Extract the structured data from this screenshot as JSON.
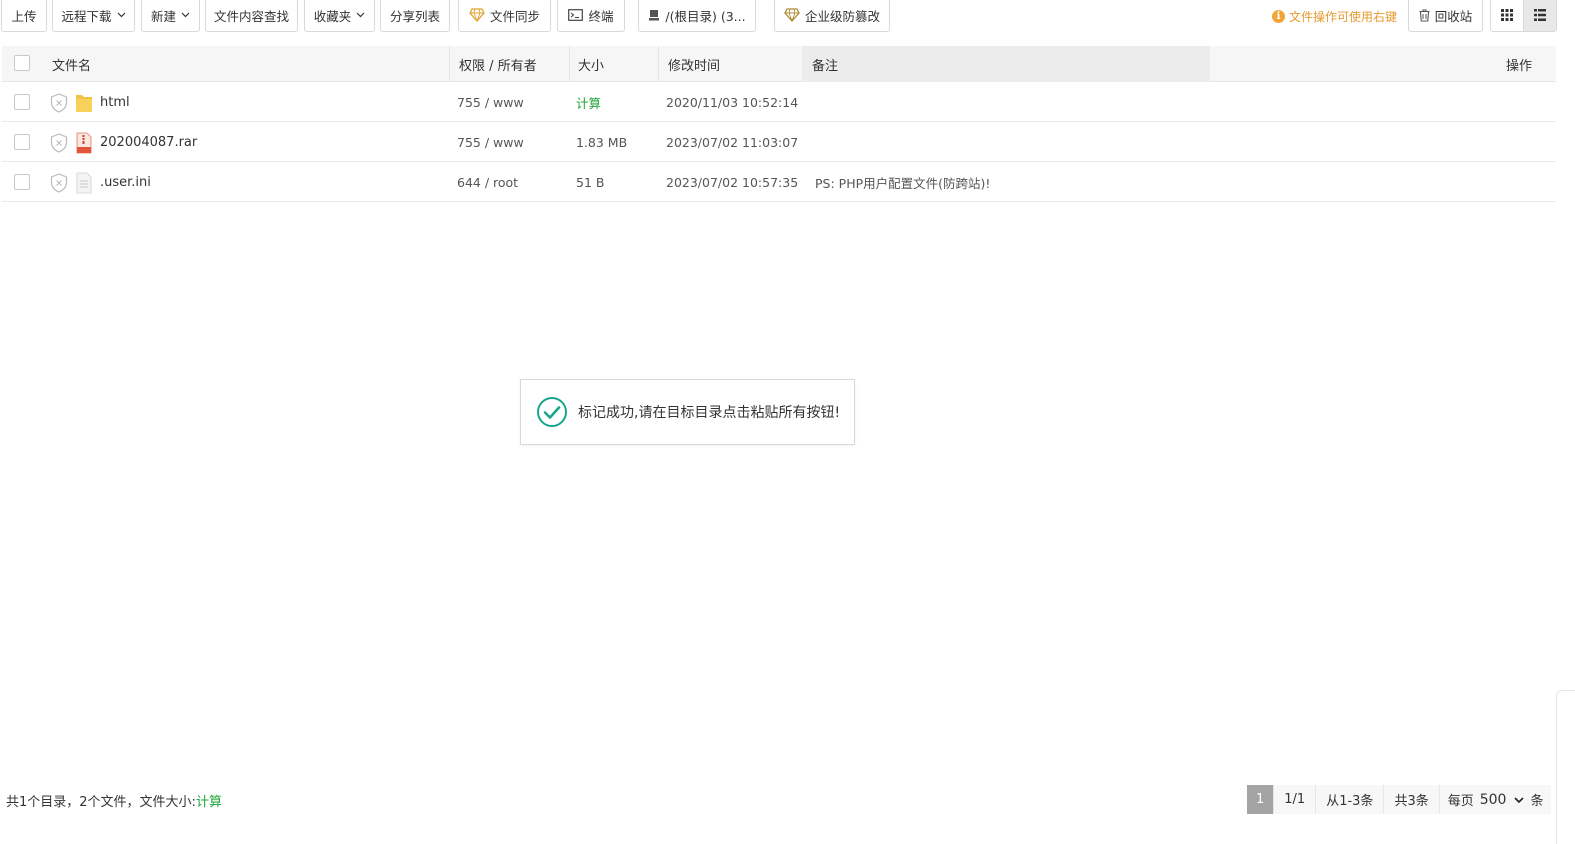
{
  "toolbar": {
    "upload": "上传",
    "remote_download": "远程下载",
    "new": "新建",
    "content_search": "文件内容查找",
    "favorites": "收藏夹",
    "share_list": "分享列表",
    "file_sync": "文件同步",
    "terminal": "终端",
    "path": "/(根目录) (3...",
    "tamper_proof": "企业级防篡改",
    "tip": "文件操作可使用右键",
    "recycle_bin": "回收站"
  },
  "table": {
    "headers": {
      "name": "文件名",
      "perm_owner": "权限 / 所有者",
      "size": "大小",
      "mtime": "修改时间",
      "note": "备注",
      "actions": "操作"
    },
    "rows": [
      {
        "name": "html",
        "type": "folder",
        "perm": "755 / www",
        "size": "计算",
        "mtime": "2020/11/03 10:52:14",
        "note": ""
      },
      {
        "name": "202004087.rar",
        "type": "rar",
        "perm": "755 / www",
        "size": "1.83 MB",
        "mtime": "2023/07/02 11:03:07",
        "note": ""
      },
      {
        "name": ".user.ini",
        "type": "file",
        "perm": "644 / root",
        "size": "51 B",
        "mtime": "2023/07/02 10:57:35",
        "note": "PS: PHP用户配置文件(防跨站)!"
      }
    ]
  },
  "toast": {
    "message": "标记成功,请在目标目录点击粘贴所有按钮!"
  },
  "footer": {
    "summary": "共1个目录，2个文件，文件大小: ",
    "calc": "计算"
  },
  "pager": {
    "current": "1",
    "pages": "1/1",
    "range": "从1-3条",
    "total": "共3条",
    "per_page_label": "每页",
    "per_page_value": "500",
    "unit": "条"
  },
  "colors": {
    "accent_green": "#20a53a",
    "tip_orange": "#e79a2f"
  }
}
